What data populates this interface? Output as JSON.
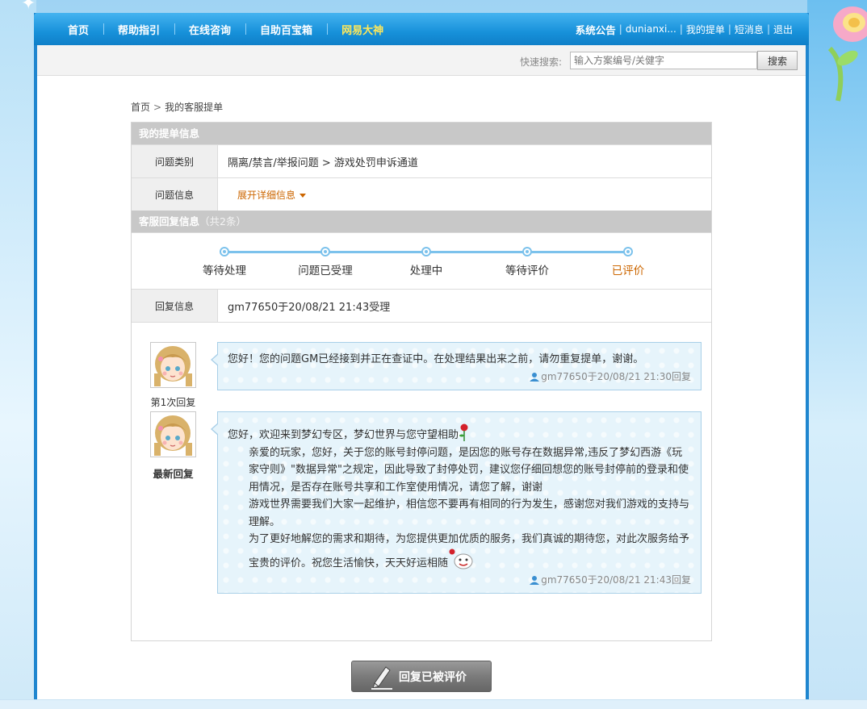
{
  "nav": {
    "items": [
      {
        "label": "首页"
      },
      {
        "label": "帮助指引"
      },
      {
        "label": "在线咨询"
      },
      {
        "label": "自助百宝箱"
      },
      {
        "label": "网易大神"
      }
    ],
    "right": {
      "notice": "系统公告",
      "username": "dunianxi...",
      "my_tickets": "我的提单",
      "messages": "短消息",
      "logout": "退出"
    }
  },
  "search": {
    "label": "快速搜索:",
    "placeholder": "输入方案编号/关健字",
    "button": "搜索"
  },
  "breadcrumb": {
    "home": "首页",
    "arrow": ">",
    "current": "我的客服提单"
  },
  "ticket": {
    "section_title": "我的提单信息",
    "category_label": "问题类别",
    "category_value": "隔离/禁言/举报问题 > 游戏处罚申诉通道",
    "info_label": "问题信息",
    "expand_label": "展开详细信息"
  },
  "reply_section": {
    "title": "客服回复信息",
    "count": "（共2条）",
    "steps": [
      {
        "label": "等待处理"
      },
      {
        "label": "问题已受理"
      },
      {
        "label": "处理中"
      },
      {
        "label": "等待评价"
      },
      {
        "label": "已评价"
      }
    ],
    "reply_info_label": "回复信息",
    "reply_info_value": "gm77650于20/08/21 21:43受理"
  },
  "replies": [
    {
      "caption": "第1次回复",
      "text": "您好！您的问题GM已经接到并正在查证中。在处理结果出来之前，请勿重复提单，谢谢。",
      "meta": "gm77650于20/08/21 21:30回复"
    },
    {
      "caption": "最新回复",
      "p1": "您好，欢迎来到梦幻专区，梦幻世界与您守望相助",
      "p2": "亲爱的玩家，您好，关于您的账号封停问题，是因您的账号存在数据异常,违反了梦幻西游《玩家守则》\"数据异常\"之规定，因此导致了封停处罚，建议您仔细回想您的账号封停前的登录和使用情况，是否存在账号共享和工作室使用情况，请您了解，谢谢",
      "p3": "游戏世界需要我们大家一起维护，相信您不要再有相同的行为发生，感谢您对我们游戏的支持与理解。",
      "p4": "为了更好地解您的需求和期待，为您提供更加优质的服务，我们真诚的期待您，对此次服务给予宝贵的评价。祝您生活愉快，天天好运相随",
      "meta": "gm77650于20/08/21 21:43回复"
    }
  ],
  "rate_button": "回复已被评价",
  "colors": {
    "nav_blue": "#1791da",
    "nav_highlight": "#ffe85a",
    "accent_orange": "#cc6600",
    "step_blue": "#7cc2ec"
  }
}
